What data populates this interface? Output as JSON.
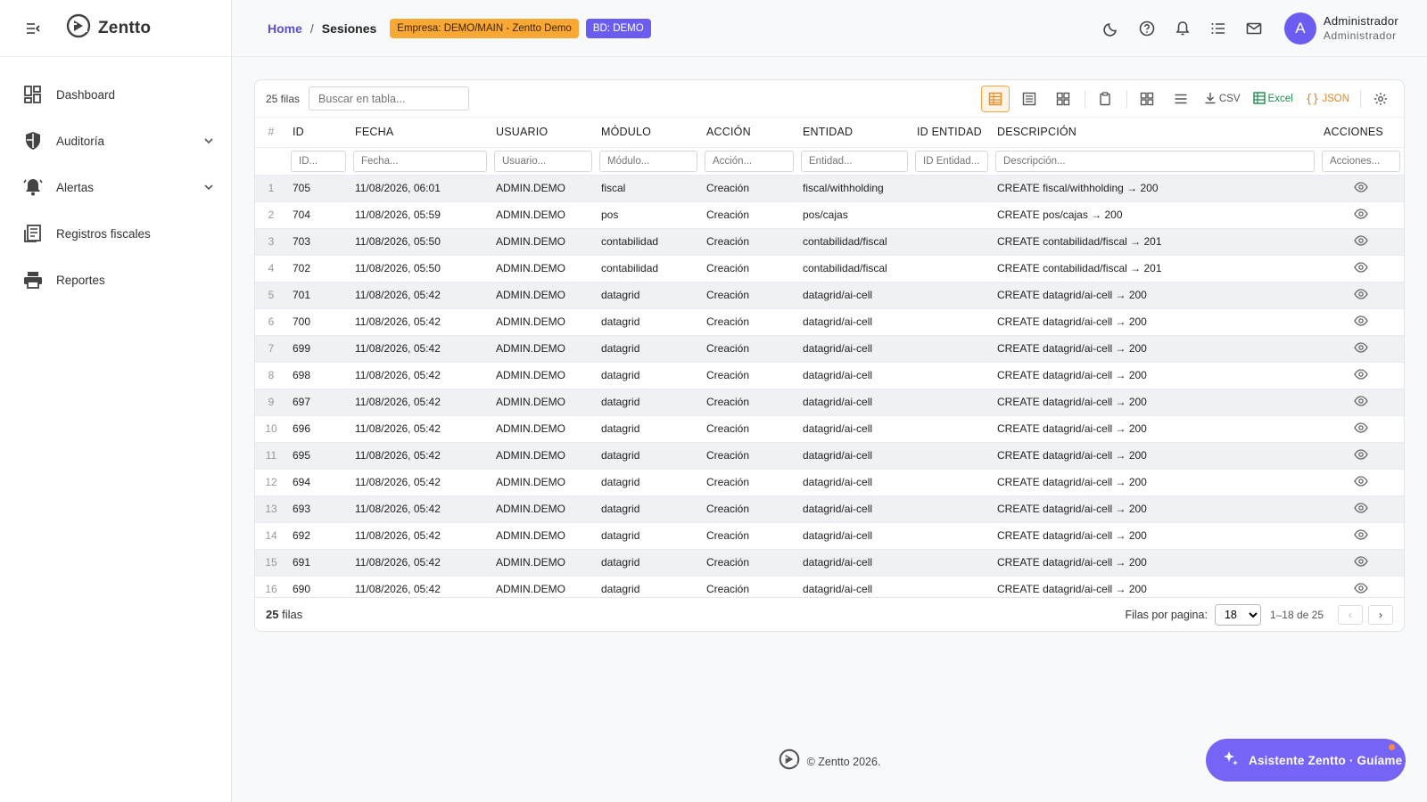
{
  "app": {
    "name": "Zentto"
  },
  "sidebar": {
    "items": [
      {
        "label": "Dashboard",
        "icon": "dashboard-icon",
        "expandable": false
      },
      {
        "label": "Auditoría",
        "icon": "shield-icon",
        "expandable": true
      },
      {
        "label": "Alertas",
        "icon": "bell-icon",
        "expandable": true
      },
      {
        "label": "Registros fiscales",
        "icon": "receipt-icon",
        "expandable": false
      },
      {
        "label": "Reportes",
        "icon": "printer-icon",
        "expandable": false
      }
    ]
  },
  "header": {
    "breadcrumb_home": "Home",
    "breadcrumb_sep": "/",
    "breadcrumb_current": "Sesiones",
    "chip_empresa": "Empresa: DEMO/MAIN - Zentto Demo",
    "chip_bd": "BD: DEMO",
    "avatar_initial": "A",
    "user_name": "Administrador",
    "user_role": "Administrador",
    "icons": [
      "moon-icon",
      "help-icon",
      "bell-icon",
      "list-icon",
      "mail-icon"
    ]
  },
  "grid": {
    "row_count_label": "25 filas",
    "search_placeholder": "Buscar en tabla...",
    "export_csv": "CSV",
    "export_excel": "Excel",
    "export_json": "JSON",
    "columns": [
      "#",
      "ID",
      "FECHA",
      "USUARIO",
      "MÓDULO",
      "ACCIÓN",
      "ENTIDAD",
      "ID ENTIDAD",
      "DESCRIPCIÓN",
      "ACCIONES"
    ],
    "filters": [
      "ID...",
      "Fecha...",
      "Usuario...",
      "Módulo...",
      "Acción...",
      "Entidad...",
      "ID Entidad...",
      "Descripción...",
      "Acciones..."
    ],
    "rows": [
      [
        "1",
        "705",
        "11/08/2026, 06:01",
        "ADMIN.DEMO",
        "fiscal",
        "Creación",
        "fiscal/withholding",
        "",
        "CREATE fiscal/withholding → 200"
      ],
      [
        "2",
        "704",
        "11/08/2026, 05:59",
        "ADMIN.DEMO",
        "pos",
        "Creación",
        "pos/cajas",
        "",
        "CREATE pos/cajas → 200"
      ],
      [
        "3",
        "703",
        "11/08/2026, 05:50",
        "ADMIN.DEMO",
        "contabilidad",
        "Creación",
        "contabilidad/fiscal",
        "",
        "CREATE contabilidad/fiscal → 201"
      ],
      [
        "4",
        "702",
        "11/08/2026, 05:50",
        "ADMIN.DEMO",
        "contabilidad",
        "Creación",
        "contabilidad/fiscal",
        "",
        "CREATE contabilidad/fiscal → 201"
      ],
      [
        "5",
        "701",
        "11/08/2026, 05:42",
        "ADMIN.DEMO",
        "datagrid",
        "Creación",
        "datagrid/ai-cell",
        "",
        "CREATE datagrid/ai-cell → 200"
      ],
      [
        "6",
        "700",
        "11/08/2026, 05:42",
        "ADMIN.DEMO",
        "datagrid",
        "Creación",
        "datagrid/ai-cell",
        "",
        "CREATE datagrid/ai-cell → 200"
      ],
      [
        "7",
        "699",
        "11/08/2026, 05:42",
        "ADMIN.DEMO",
        "datagrid",
        "Creación",
        "datagrid/ai-cell",
        "",
        "CREATE datagrid/ai-cell → 200"
      ],
      [
        "8",
        "698",
        "11/08/2026, 05:42",
        "ADMIN.DEMO",
        "datagrid",
        "Creación",
        "datagrid/ai-cell",
        "",
        "CREATE datagrid/ai-cell → 200"
      ],
      [
        "9",
        "697",
        "11/08/2026, 05:42",
        "ADMIN.DEMO",
        "datagrid",
        "Creación",
        "datagrid/ai-cell",
        "",
        "CREATE datagrid/ai-cell → 200"
      ],
      [
        "10",
        "696",
        "11/08/2026, 05:42",
        "ADMIN.DEMO",
        "datagrid",
        "Creación",
        "datagrid/ai-cell",
        "",
        "CREATE datagrid/ai-cell → 200"
      ],
      [
        "11",
        "695",
        "11/08/2026, 05:42",
        "ADMIN.DEMO",
        "datagrid",
        "Creación",
        "datagrid/ai-cell",
        "",
        "CREATE datagrid/ai-cell → 200"
      ],
      [
        "12",
        "694",
        "11/08/2026, 05:42",
        "ADMIN.DEMO",
        "datagrid",
        "Creación",
        "datagrid/ai-cell",
        "",
        "CREATE datagrid/ai-cell → 200"
      ],
      [
        "13",
        "693",
        "11/08/2026, 05:42",
        "ADMIN.DEMO",
        "datagrid",
        "Creación",
        "datagrid/ai-cell",
        "",
        "CREATE datagrid/ai-cell → 200"
      ],
      [
        "14",
        "692",
        "11/08/2026, 05:42",
        "ADMIN.DEMO",
        "datagrid",
        "Creación",
        "datagrid/ai-cell",
        "",
        "CREATE datagrid/ai-cell → 200"
      ],
      [
        "15",
        "691",
        "11/08/2026, 05:42",
        "ADMIN.DEMO",
        "datagrid",
        "Creación",
        "datagrid/ai-cell",
        "",
        "CREATE datagrid/ai-cell → 200"
      ],
      [
        "16",
        "690",
        "11/08/2026, 05:42",
        "ADMIN.DEMO",
        "datagrid",
        "Creación",
        "datagrid/ai-cell",
        "",
        "CREATE datagrid/ai-cell → 200"
      ]
    ],
    "footer_count_number": "25",
    "footer_count_word": "filas",
    "rows_per_page_label": "Filas por pagina:",
    "rows_per_page_value": "18",
    "range_label": "1–18 de 25",
    "prev_label": "‹",
    "next_label": "›"
  },
  "page_footer": {
    "copyright": "© Zentto 2026."
  },
  "assistant": {
    "label": "Asistente Zentto · Guíame"
  },
  "colors": {
    "accent": "#6a5df0",
    "brand_orange": "#f9a834",
    "assistant": "#7564f5"
  }
}
